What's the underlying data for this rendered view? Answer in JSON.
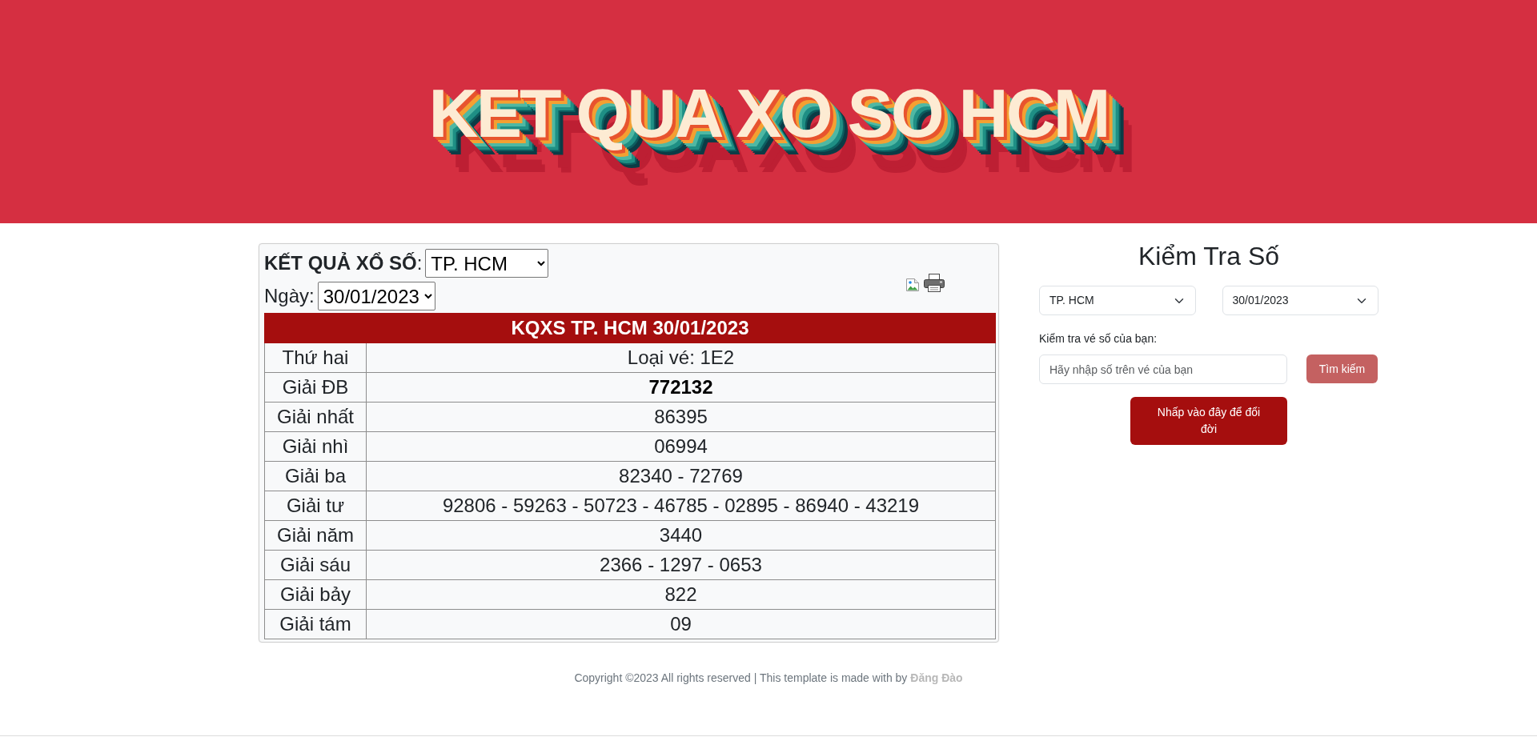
{
  "header": {
    "title": "KET QUA XO SO HCM"
  },
  "results": {
    "heading": "**KẾT QUẢ XỔ SỐ**:",
    "province_select": {
      "value": "TP. HCM"
    },
    "date_label": "Ngày:",
    "date_select": {
      "value": "30/01/2023"
    },
    "table": {
      "title": "KQXS TP. HCM 30/01/2023",
      "rows": [
        {
          "label": "Thứ hai",
          "value": "Loại vé: 1E2",
          "emphasized": false
        },
        {
          "label": "Giải ĐB",
          "value": "772132",
          "emphasized": true
        },
        {
          "label": "Giải nhất",
          "value": "86395",
          "emphasized": false
        },
        {
          "label": "Giải nhì",
          "value": "06994",
          "emphasized": false
        },
        {
          "label": "Giải ba",
          "value": "82340 - 72769",
          "emphasized": false
        },
        {
          "label": "Giải tư",
          "value": "92806 - 59263 - 50723 - 46785 - 02895 - 86940 - 43219",
          "emphasized": false
        },
        {
          "label": "Giải năm",
          "value": "3440",
          "emphasized": false
        },
        {
          "label": "Giải sáu",
          "value": "2366 - 1297 - 0653",
          "emphasized": false
        },
        {
          "label": "Giải bảy",
          "value": "822",
          "emphasized": false
        },
        {
          "label": "Giải tám",
          "value": "09",
          "emphasized": false
        }
      ]
    }
  },
  "checker": {
    "title": "Kiểm Tra Số",
    "province_select": {
      "value": "TP. HCM"
    },
    "date_select": {
      "value": "30/01/2023"
    },
    "ticket_label": "Kiểm tra vé số của bạn:",
    "ticket_input": {
      "placeholder": "Hãy nhập số trên vé của bạn"
    },
    "search_button": {
      "label": "Tìm kiếm",
      "disabled": true
    },
    "luck_button": {
      "label": "Nhấp vào đây để đổi đời"
    }
  },
  "footer": {
    "text": "Copyright ©2023 All rights reserved | This template is made with by",
    "author": "Đăng Đào"
  }
}
